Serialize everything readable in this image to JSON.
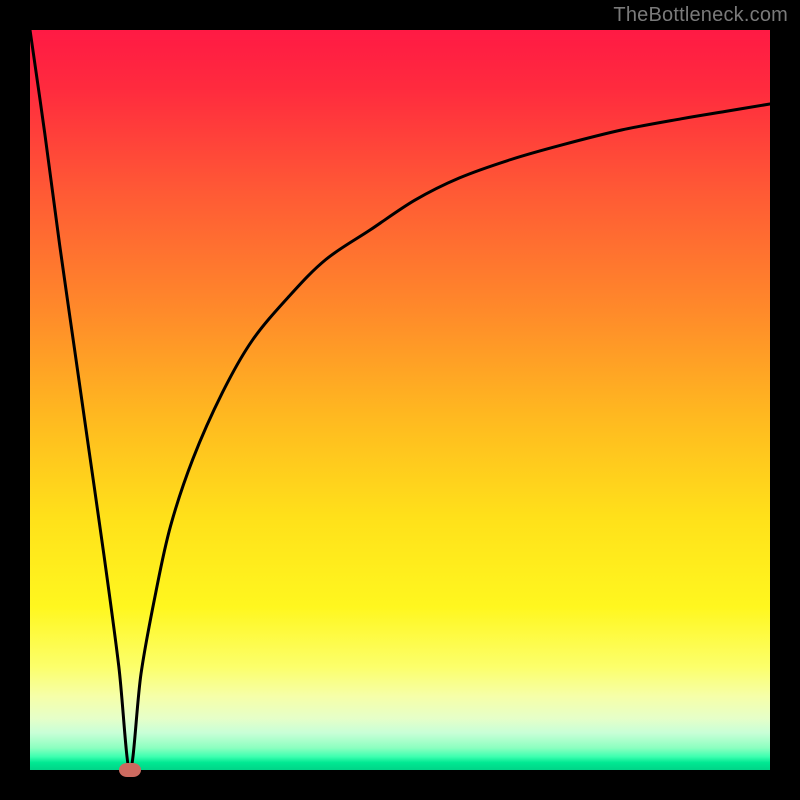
{
  "watermark": "TheBottleneck.com",
  "colors": {
    "frame": "#000000",
    "curve": "#000000",
    "marker": "#cc6a5f",
    "gradient_top": "#ff1a44",
    "gradient_bottom": "#00d488"
  },
  "chart_data": {
    "type": "line",
    "title": "",
    "xlabel": "",
    "ylabel": "",
    "xlim": [
      0,
      100
    ],
    "ylim": [
      0,
      100
    ],
    "grid": false,
    "legend": false,
    "series": [
      {
        "name": "curve",
        "x": [
          0,
          2,
          4,
          6,
          8,
          10,
          12,
          13.5,
          15,
          17,
          19,
          22,
          26,
          30,
          35,
          40,
          46,
          52,
          58,
          65,
          72,
          80,
          88,
          94,
          100
        ],
        "values": [
          100,
          86,
          71,
          57,
          43,
          29,
          14,
          0,
          13,
          24,
          33,
          42,
          51,
          58,
          64,
          69,
          73,
          77,
          80,
          82.5,
          84.5,
          86.5,
          88,
          89,
          90
        ]
      }
    ],
    "marker": {
      "x": 13.5,
      "y": 0
    },
    "annotations": []
  }
}
